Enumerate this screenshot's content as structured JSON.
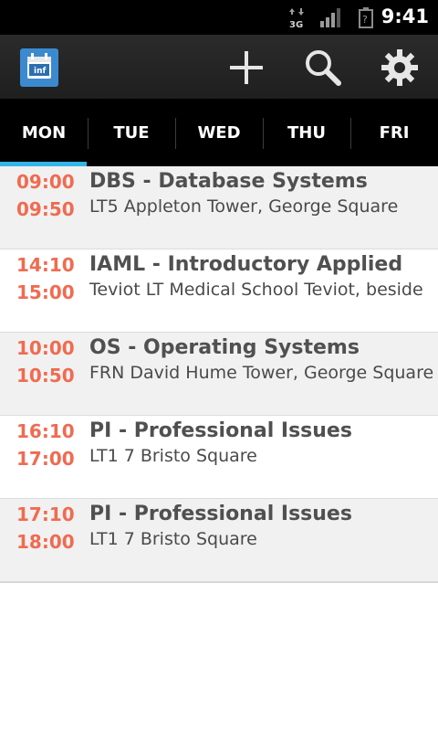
{
  "status_bar": {
    "network_type": "3G",
    "battery_text": "?",
    "time": "9:41",
    "icons": [
      "data-transfer-icon",
      "signal-icon",
      "battery-icon"
    ]
  },
  "action_bar": {
    "app_icon_text": "inf",
    "icons": [
      "calendar-app-icon",
      "add-icon",
      "search-icon",
      "settings-icon"
    ]
  },
  "tabs": [
    {
      "label": "MON",
      "active": true
    },
    {
      "label": "TUE"
    },
    {
      "label": "WED"
    },
    {
      "label": "THU"
    },
    {
      "label": "FRI"
    }
  ],
  "events": [
    {
      "start": "09:00",
      "end": "09:50",
      "title": "DBS - Database Systems",
      "location": "LT5 Appleton Tower, George Square"
    },
    {
      "start": "14:10",
      "end": "15:00",
      "title": "IAML - Introductory Applied",
      "location": "Teviot LT Medical School Teviot, beside"
    },
    {
      "start": "10:00",
      "end": "10:50",
      "title": "OS - Operating Systems",
      "location": "FRN David Hume Tower, George Square"
    },
    {
      "start": "16:10",
      "end": "17:00",
      "title": "PI - Professional Issues",
      "location": "LT1 7 Bristo Square"
    },
    {
      "start": "17:10",
      "end": "18:00",
      "title": "PI - Professional Issues",
      "location": "LT1 7 Bristo Square"
    }
  ],
  "colors": {
    "accent": "#33b5e5",
    "time_text": "#f06b51",
    "title_text": "#505050",
    "alt_row": "#f1f1f1"
  }
}
